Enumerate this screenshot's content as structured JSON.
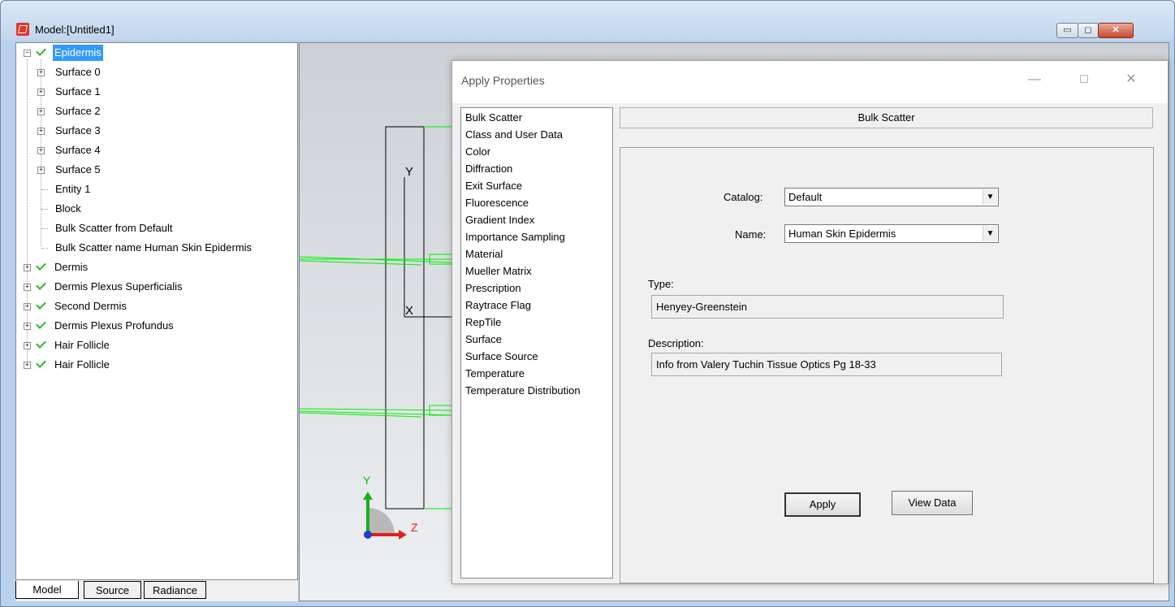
{
  "window": {
    "title": "Model:[Untitled1]",
    "min_glyph": "▭",
    "max_glyph": "◻",
    "close_glyph": "✕"
  },
  "tree": {
    "root": {
      "label": "Epidermis",
      "selected": true
    },
    "children": [
      "Surface 0",
      "Surface 1",
      "Surface 2",
      "Surface 3",
      "Surface 4",
      "Surface 5",
      "Entity 1",
      "Block",
      "Bulk Scatter from Default",
      "Bulk Scatter name Human Skin Epidermis"
    ],
    "siblings": [
      "Dermis",
      "Dermis Plexus Superficialis",
      "Second Dermis",
      "Dermis Plexus Profundus",
      "Hair Follicle",
      "Hair Follicle"
    ]
  },
  "tabs": [
    "Model",
    "Source",
    "Radiance"
  ],
  "viewport": {
    "axis_y": "Y",
    "axis_x": "X",
    "triad_y": "Y",
    "triad_z": "Z"
  },
  "dialog": {
    "title": "Apply Properties",
    "min_glyph": "—",
    "max_glyph": "☐",
    "close_glyph": "✕",
    "properties": [
      "Bulk Scatter",
      "Class and User Data",
      "Color",
      "Diffraction",
      "Exit Surface",
      "Fluorescence",
      "Gradient Index",
      "Importance Sampling",
      "Material",
      "Mueller Matrix",
      "Prescription",
      "Raytrace Flag",
      "RepTile",
      "Surface",
      "Surface Source",
      "Temperature",
      "Temperature Distribution"
    ],
    "section_header": "Bulk Scatter",
    "catalog": {
      "label": "Catalog:",
      "value": "Default"
    },
    "name": {
      "label": "Name:",
      "value": "Human Skin Epidermis"
    },
    "type": {
      "label": "Type:",
      "value": "Henyey-Greenstein"
    },
    "description": {
      "label": "Description:",
      "value": "Info from Valery Tuchin Tissue Optics Pg 18-33"
    },
    "apply_label": "Apply",
    "view_data_label": "View Data"
  },
  "colors": {
    "selection": "#3399ff",
    "check": "#2db52d",
    "ray": "#00ee00",
    "triad_x": "#e02020",
    "triad_y": "#18b018",
    "triad_z": "#2040d0"
  }
}
